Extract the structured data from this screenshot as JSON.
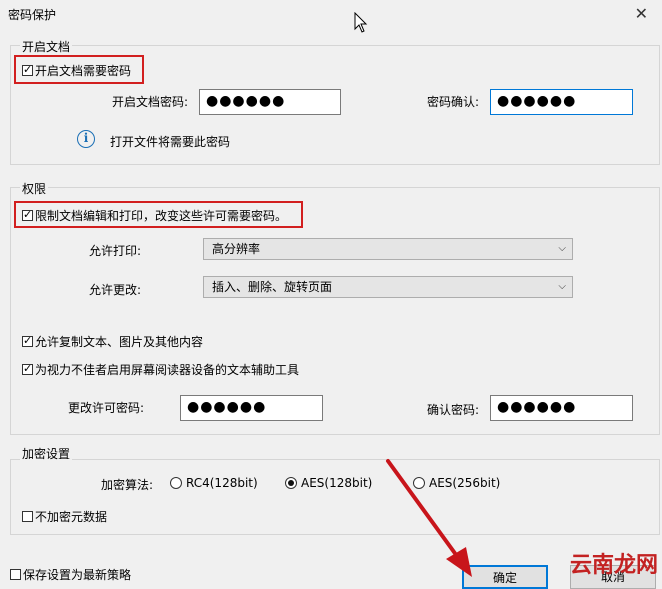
{
  "window": {
    "title": "密码保护"
  },
  "open_section": {
    "legend": "开启文档",
    "require_password_label": "开启文档需要密码",
    "require_password_checked": true,
    "open_password_label": "开启文档密码:",
    "open_password_value": "●●●●●●",
    "confirm_label": "密码确认:",
    "confirm_value": "●●●●●●",
    "info_text": "打开文件将需要此密码"
  },
  "permissions": {
    "legend": "权限",
    "restrict_label": "限制文档编辑和打印，改变这些许可需要密码。",
    "restrict_checked": true,
    "print_label": "允许打印:",
    "print_value": "高分辨率",
    "change_label": "允许更改:",
    "change_value": "插入、删除、旋转页面",
    "copy_label": "允许复制文本、图片及其他内容",
    "copy_checked": true,
    "access_label": "为视力不佳者启用屏幕阅读器设备的文本辅助工具",
    "access_checked": true,
    "change_password_label": "更改许可密码:",
    "change_password_value": "●●●●●●",
    "confirm_label": "确认密码:",
    "confirm_value": "●●●●●●"
  },
  "encryption": {
    "legend": "加密设置",
    "algorithm_label": "加密算法:",
    "options": [
      "RC4(128bit)",
      "AES(128bit)",
      "AES(256bit)"
    ],
    "selected": "AES(128bit)",
    "no_metadata_label": "不加密元数据",
    "no_metadata_checked": false
  },
  "footer": {
    "save_policy_label": "保存设置为最新策略",
    "save_policy_checked": false,
    "ok_label": "确定",
    "cancel_label": "取消"
  },
  "watermark": {
    "text": "云南龙网"
  },
  "colors": {
    "highlight": "#d21f1f",
    "focus": "#0078d7",
    "arrow": "#c8151b"
  }
}
